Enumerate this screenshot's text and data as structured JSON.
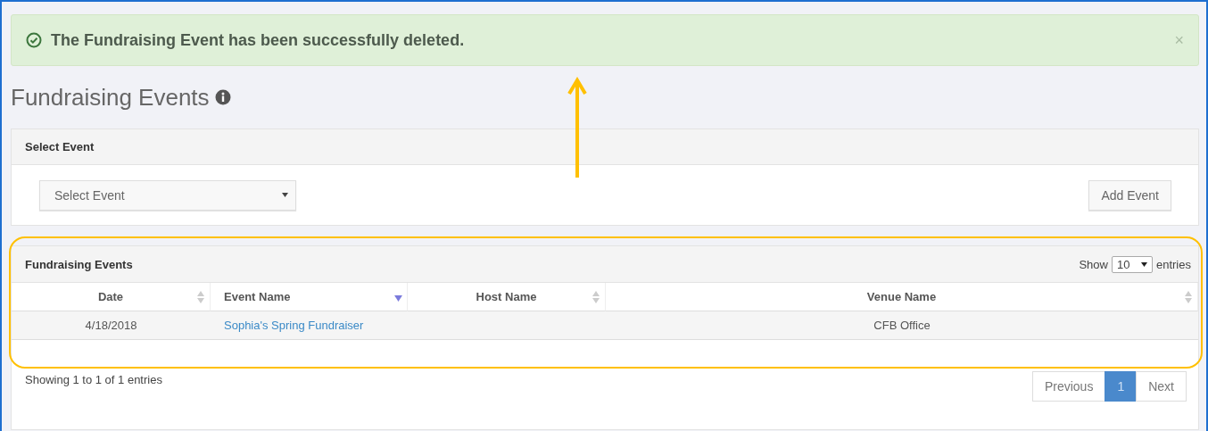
{
  "alert": {
    "message": "The Fundraising Event has been successfully deleted.",
    "close": "×"
  },
  "page_title": "Fundraising Events",
  "select_panel": {
    "heading": "Select Event",
    "dropdown": {
      "value": "Select Event"
    },
    "button": "Add Event"
  },
  "table_panel": {
    "heading": "Fundraising Events",
    "length": {
      "prefix": "Show",
      "value": "10",
      "suffix": "entries"
    },
    "columns": [
      {
        "label": "Date",
        "sorted": false
      },
      {
        "label": "Event Name",
        "sorted": true
      },
      {
        "label": "Host Name",
        "sorted": false
      },
      {
        "label": "Venue Name",
        "sorted": false
      }
    ],
    "rows": [
      {
        "date": "4/18/2018",
        "event_name": "Sophia's Spring Fundraiser",
        "venue_name": "CFB Office"
      }
    ],
    "info": "Showing 1 to 1 of 1 entries",
    "pagination": [
      {
        "label": "Previous",
        "selected": false
      },
      {
        "label": "1",
        "selected": true
      },
      {
        "label": "Next",
        "selected": false
      }
    ]
  }
}
